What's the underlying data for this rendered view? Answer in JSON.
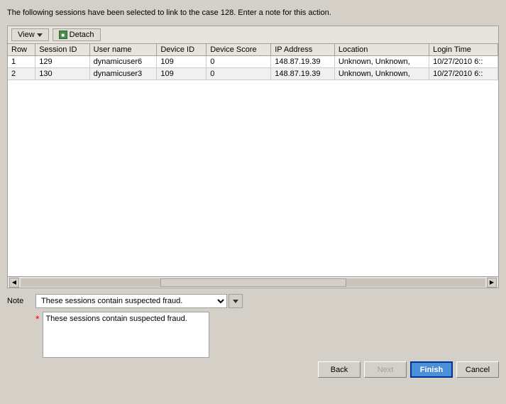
{
  "description": "The following sessions have been selected to link to the case 128. Enter a note for this action.",
  "toolbar": {
    "view_label": "View",
    "detach_label": "Detach"
  },
  "table": {
    "columns": [
      "Row",
      "Session ID",
      "User name",
      "Device ID",
      "Device Score",
      "IP Address",
      "Location",
      "Login Time"
    ],
    "rows": [
      {
        "row": "1",
        "session_id": "129",
        "user_name": "dynamicuser6",
        "device_id": "109",
        "device_score": "0",
        "ip_address": "148.87.19.39",
        "location": "Unknown, Unknown,",
        "login_time": "10/27/2010 6::"
      },
      {
        "row": "2",
        "session_id": "130",
        "user_name": "dynamicuser3",
        "device_id": "109",
        "device_score": "0",
        "ip_address": "148.87.19.39",
        "location": "Unknown, Unknown,",
        "login_time": "10/27/2010 6::"
      }
    ]
  },
  "note": {
    "label": "Note",
    "dropdown_value": "These sessions contain suspected fraud.",
    "textarea_value": "These sessions contain suspected fraud."
  },
  "buttons": {
    "back_label": "Back",
    "next_label": "Next",
    "finish_label": "Finish",
    "cancel_label": "Cancel"
  }
}
